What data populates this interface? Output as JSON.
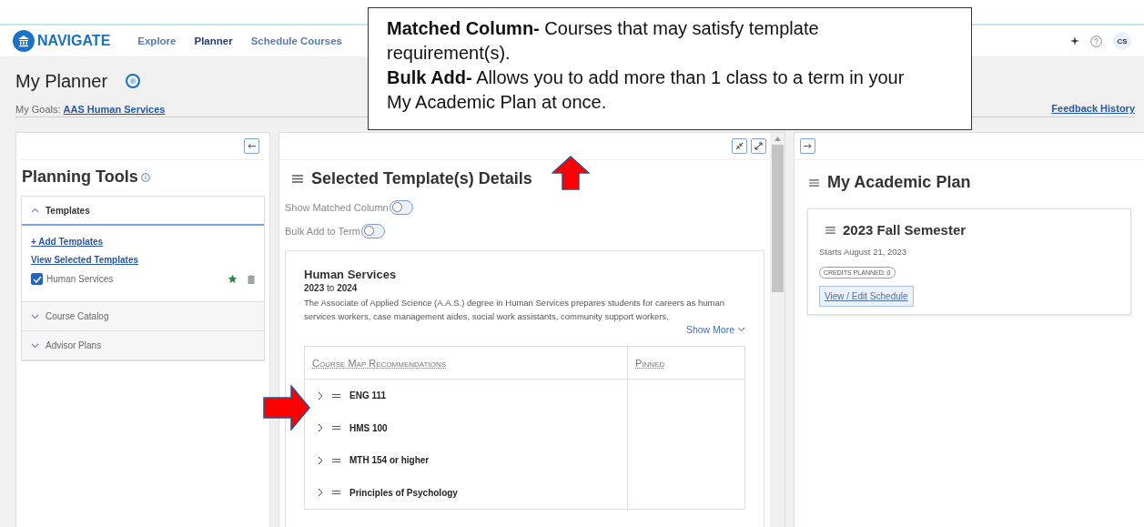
{
  "nav": {
    "logo": "NAVIGATE",
    "links": [
      {
        "label": "Explore",
        "selected": false
      },
      {
        "label": "Planner",
        "selected": true
      },
      {
        "label": "Schedule Courses",
        "selected": false
      }
    ],
    "user_initials": "CS"
  },
  "callout": {
    "paragraphs": [
      "**Matched Column-** Courses that may satisfy template requirement(s).",
      "**Bulk Add-** Allows you to add more than 1 class to a term in your My Academic Plan at once."
    ]
  },
  "page": {
    "title": "My Planner",
    "goals_label": "My Goals:",
    "goals_link": "AAS Human Services",
    "feedback_link": "Feedback History"
  },
  "planning_tools": {
    "title": "Planning Tools",
    "sections": [
      {
        "label": "Templates",
        "expanded": true,
        "links": [
          "+ Add Templates",
          "View Selected Templates"
        ],
        "templates": [
          {
            "name": "Human Services",
            "checked": true,
            "starred": true
          }
        ]
      },
      {
        "label": "Course Catalog",
        "expanded": false
      },
      {
        "label": "Advisor Plans",
        "expanded": false
      }
    ]
  },
  "template_details": {
    "title": "Selected Template(s) Details",
    "toggles": [
      {
        "label": "Show Matched Column",
        "on": false
      },
      {
        "label": "Bulk Add to Term",
        "on": false
      }
    ],
    "template": {
      "name": "Human Services",
      "years": "**2023** to **2024**",
      "description": "The Associate of Applied Science (A.A.S.) degree in Human Services prepares students for careers as human services workers, case management aides, social work assistants, community support workers,",
      "show_more": "Show More"
    },
    "table": {
      "columns": [
        "Course Map Recommendations",
        "Pinned"
      ],
      "rows": [
        {
          "course": "ENG 111",
          "expanded": false
        },
        {
          "course": "HMS 100",
          "expanded": false
        },
        {
          "course": "MTH 154 or higher",
          "expanded": false
        },
        {
          "course": "Principles of Psychology",
          "expanded": false
        }
      ]
    }
  },
  "academic_plan": {
    "title": "My Academic Plan",
    "terms": [
      {
        "name": "2023 Fall Semester",
        "starts": "Starts August 21, 2023",
        "credits": "CREDITS PLANNED: 0",
        "action": "View / Edit Schedule"
      }
    ]
  }
}
